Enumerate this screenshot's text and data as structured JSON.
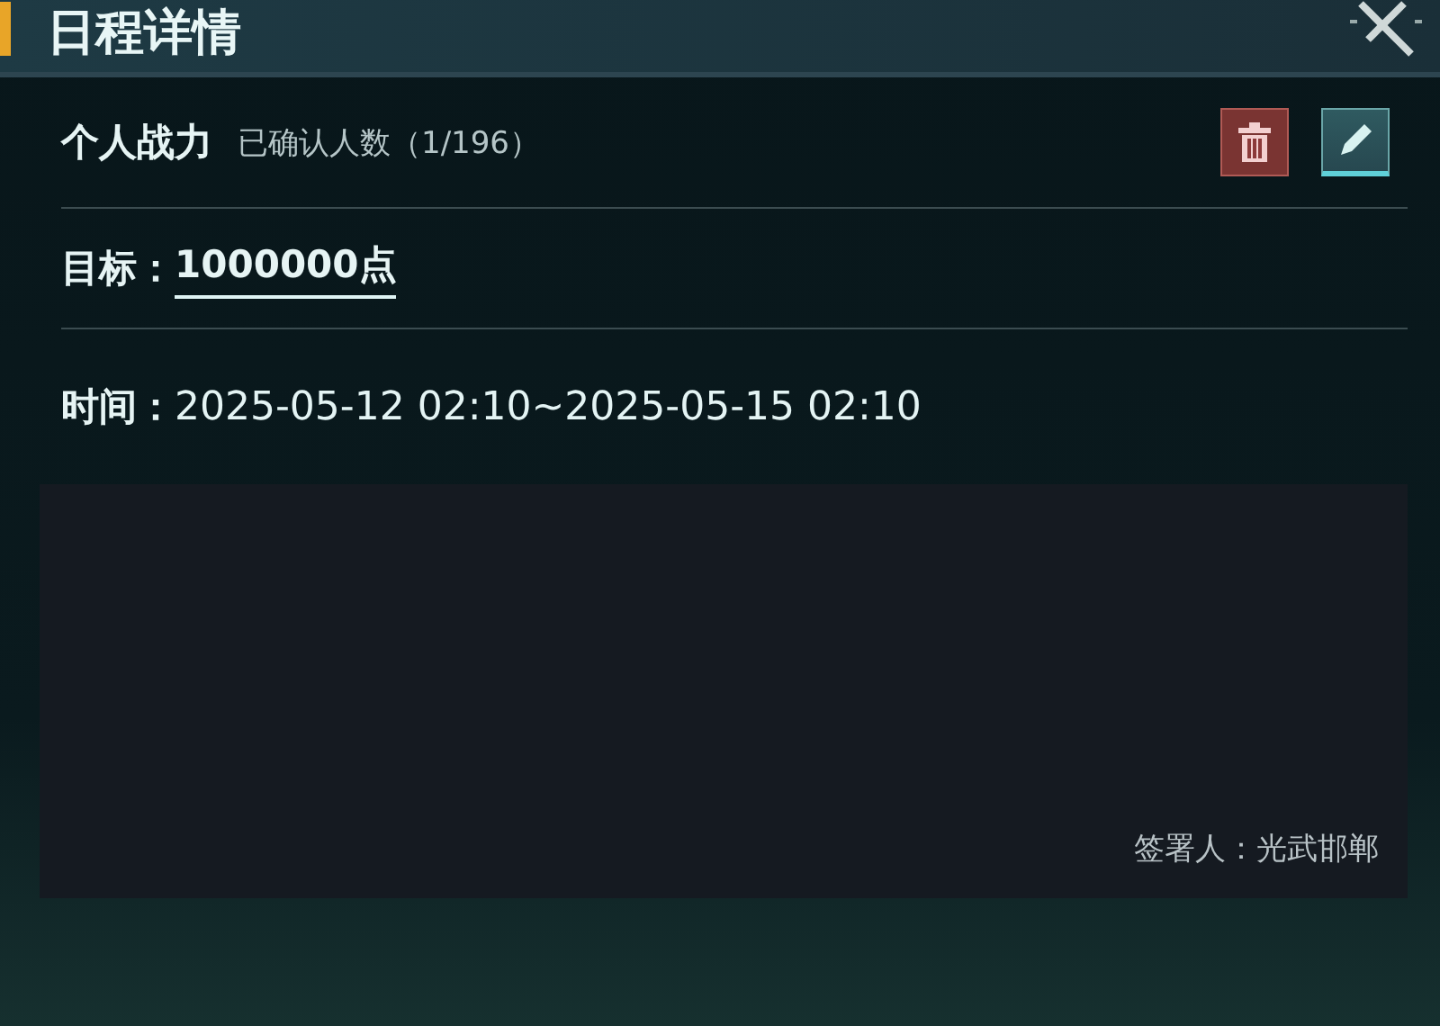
{
  "header": {
    "title": "日程详情"
  },
  "event": {
    "name": "个人战力",
    "confirmed": "已确认人数（1/196）"
  },
  "actions": [
    {
      "kind": "delete"
    },
    {
      "kind": "edit"
    }
  ],
  "goal": {
    "label": "目标：",
    "value": "1000000点"
  },
  "time": {
    "label": "时间：",
    "value": "2025-05-12 02:10~2025-05-15 02:10"
  },
  "note": {
    "signer": "签署人：光武邯郸"
  }
}
